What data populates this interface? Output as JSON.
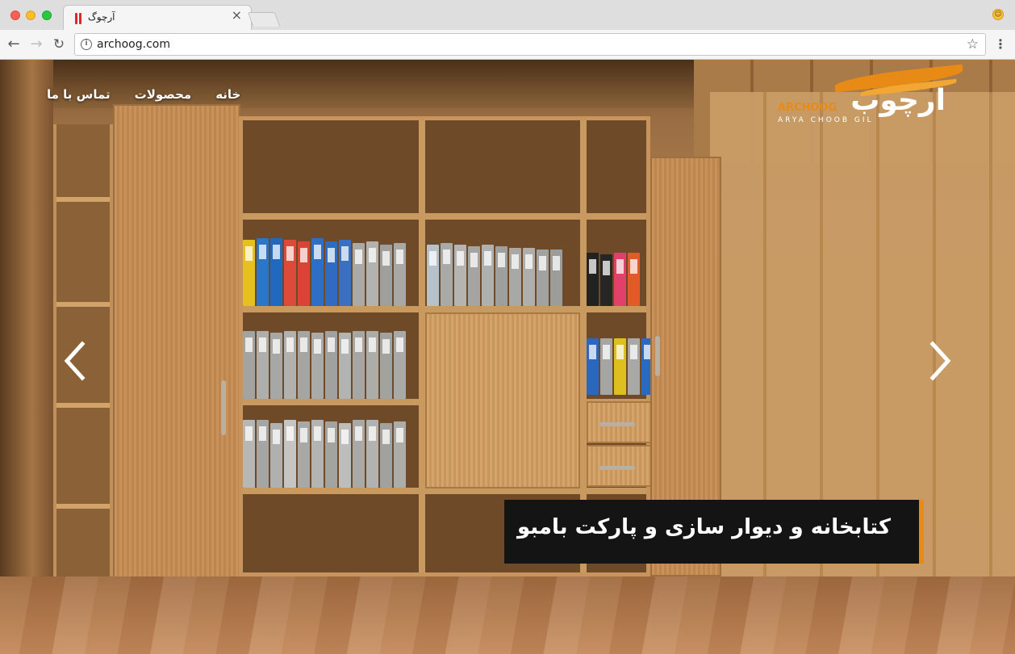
{
  "browser": {
    "tab_title": "آرچوگ",
    "tab_close": "×",
    "url": "archoog.com",
    "info_icon": "i",
    "star_icon": "☆",
    "menu_icon": "⋮",
    "back_icon": "←",
    "forward_icon": "→",
    "reload_icon": "↻",
    "profile_icon": "☺"
  },
  "nav": {
    "home": "خانه",
    "products": "محصولات",
    "contact": "تماس با ما"
  },
  "logo": {
    "mark": "ارچوب",
    "latin": "ARCHOOG",
    "tagline": "ARYA CHOOB GIL"
  },
  "slider": {
    "caption": "کتابخانه و دیوار سازی و پارکت بامبو",
    "prev_icon": "chevron-left",
    "next_icon": "chevron-right"
  },
  "colors": {
    "accent": "#e88a16",
    "caption_bg": "#141414"
  }
}
